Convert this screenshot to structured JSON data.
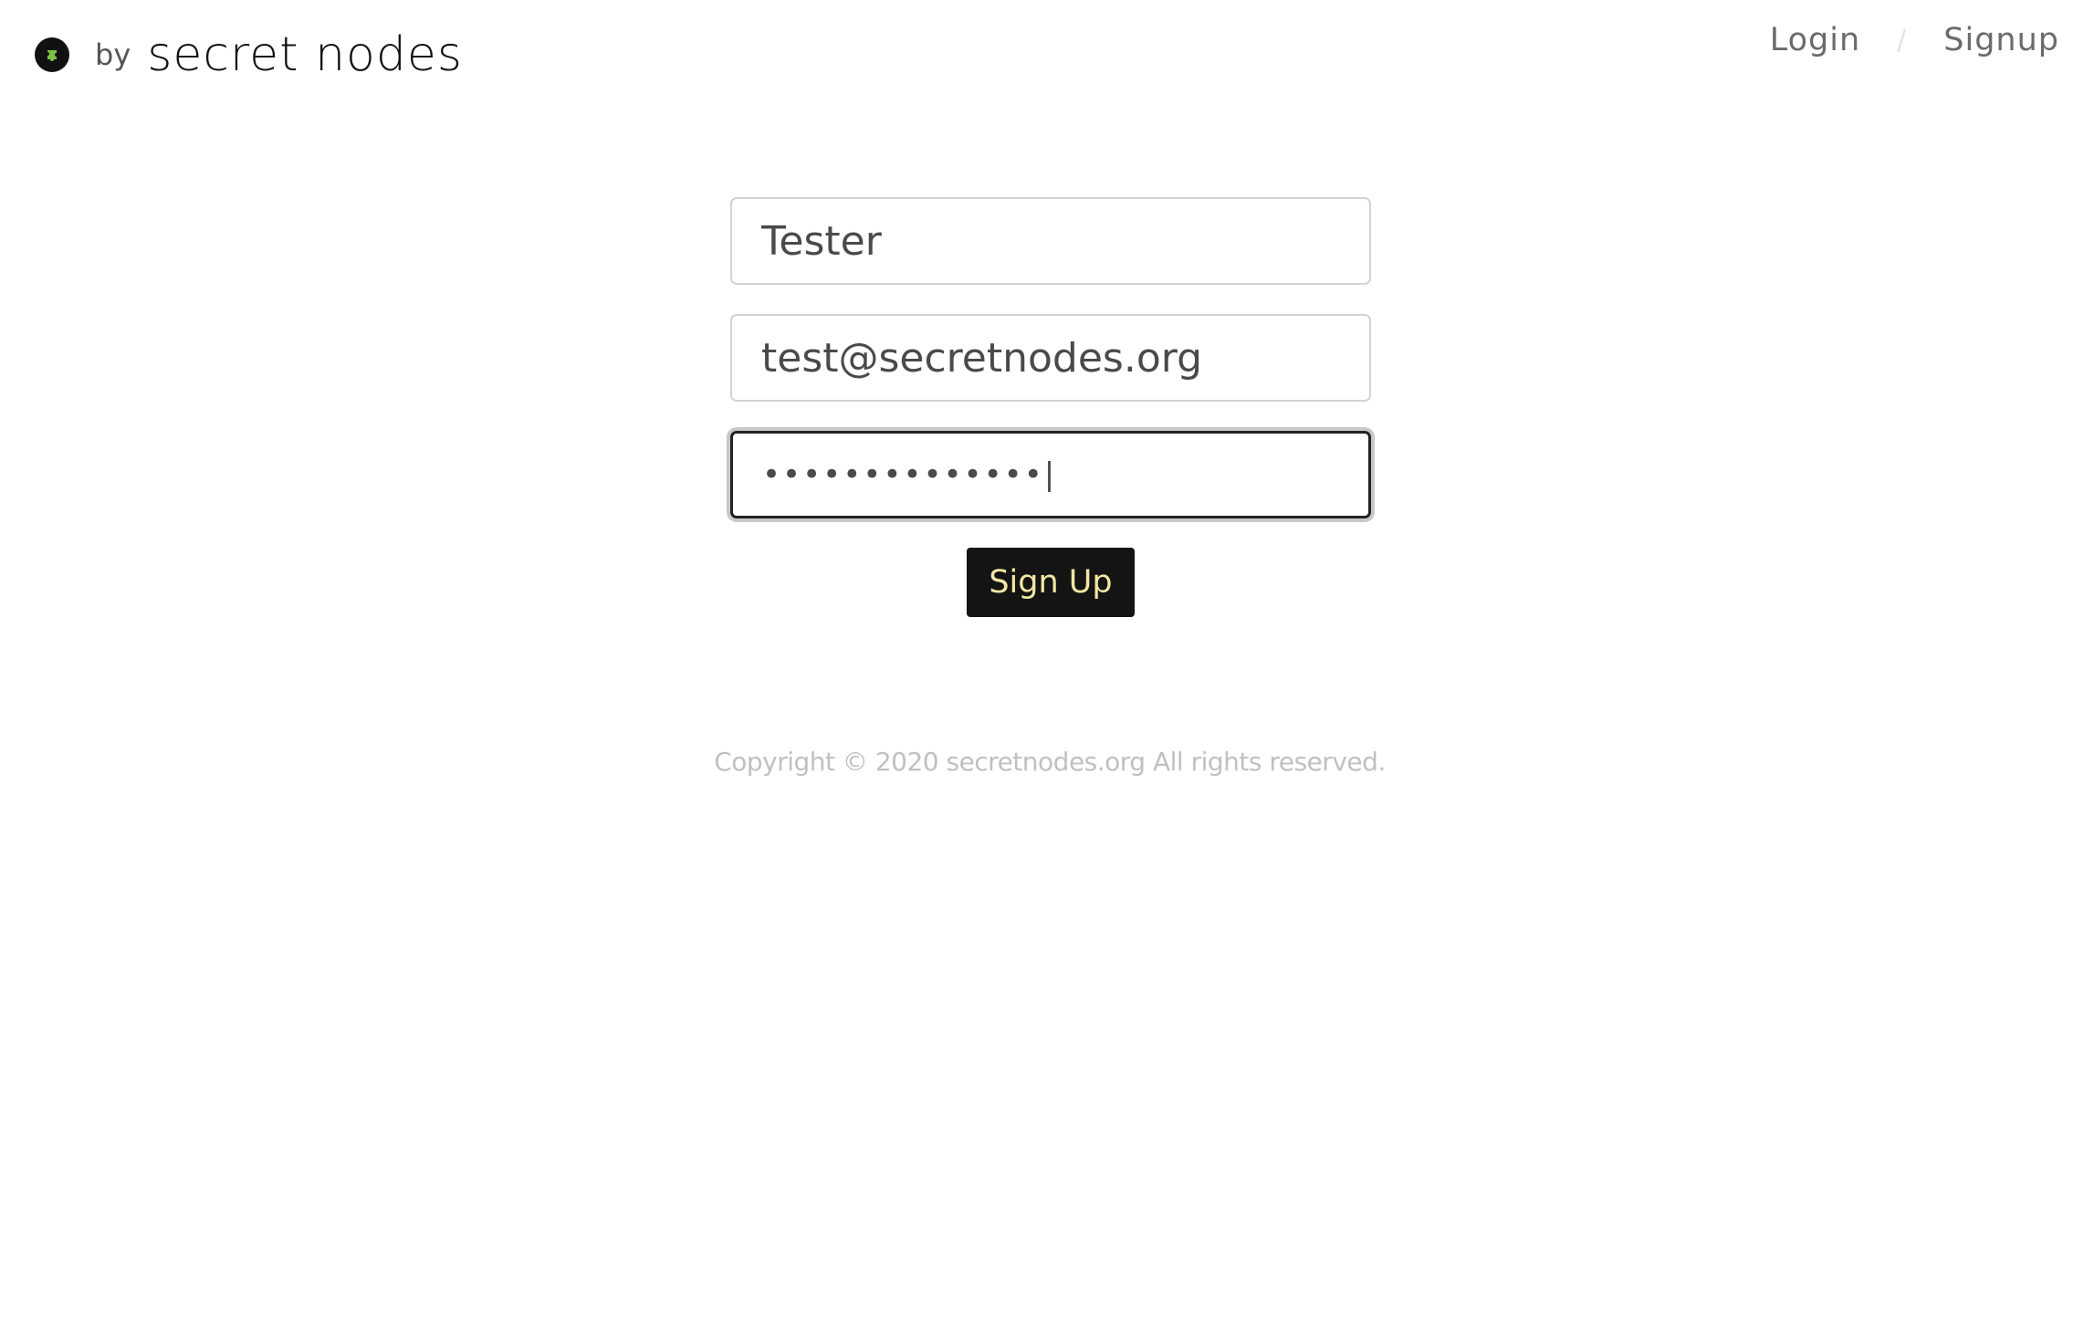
{
  "header": {
    "logo_icon": "puzzle-icon",
    "by_label": "by",
    "brand_name": "secret nodes",
    "nav": {
      "login_label": "Login",
      "separator": "/",
      "signup_label": "Signup"
    }
  },
  "form": {
    "name_value": "Tester",
    "email_value": "test@secretnodes.org",
    "password_mask": "••••••••••••••|",
    "submit_label": "Sign Up"
  },
  "footer": {
    "copyright": "Copyright © 2020 secretnodes.org All rights reserved."
  },
  "colors": {
    "button_bg": "#141414",
    "button_text": "#f2e7a4",
    "logo_accent": "#7cc242"
  }
}
